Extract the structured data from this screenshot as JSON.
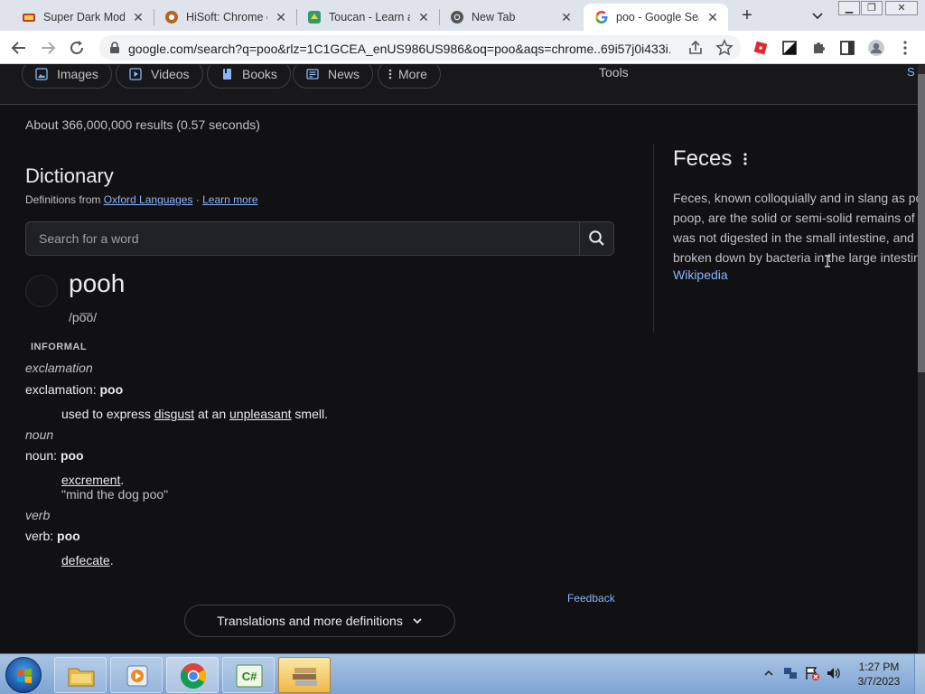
{
  "browser": {
    "tabs": [
      {
        "title": "Super Dark Mode",
        "icon": "super-dark-mode-icon",
        "active": false
      },
      {
        "title": "HiSoft: Chrome ex",
        "icon": "hisoft-icon",
        "active": false
      },
      {
        "title": "Toucan - Learn a",
        "icon": "toucan-icon",
        "active": false
      },
      {
        "title": "New Tab",
        "icon": "chrome-icon",
        "active": false
      },
      {
        "title": "poo - Google Sea",
        "icon": "google-icon",
        "active": true
      }
    ],
    "new_tab_label": "+",
    "url": "google.com/search?q=poo&rlz=1C1GCEA_enUS986US986&oq=poo&aqs=chrome..69i57j0i433i..."
  },
  "search_tabs": {
    "items": [
      {
        "label": "Images",
        "icon": "image-icon"
      },
      {
        "label": "Videos",
        "icon": "video-icon"
      },
      {
        "label": "Books",
        "icon": "book-icon"
      },
      {
        "label": "News",
        "icon": "news-icon"
      },
      {
        "label": "More",
        "icon": "more-vert-icon"
      }
    ],
    "tools": "Tools",
    "right_edge": "S"
  },
  "result_stats": "About 366,000,000 results (0.57 seconds)",
  "dictionary": {
    "title": "Dictionary",
    "from_prefix": "Definitions from ",
    "source": "Oxford Languages",
    "separator": " · ",
    "learn_more": "Learn more",
    "search_placeholder": "Search for a word",
    "word": "pooh",
    "phonetic": "/po͞o/",
    "register": "INFORMAL",
    "entries": [
      {
        "pos": "exclamation",
        "label": "exclamation: ",
        "headword": "poo",
        "def_parts": [
          "used to express ",
          "disgust",
          " at an ",
          "unpleasant",
          " smell."
        ],
        "example": ""
      },
      {
        "pos": "noun",
        "label": "noun: ",
        "headword": "poo",
        "def_parts": [
          "",
          "excrement",
          "."
        ],
        "example": "\"mind the dog poo\""
      },
      {
        "pos": "verb",
        "label": "verb: ",
        "headword": "poo",
        "def_parts": [
          "",
          "defecate",
          "."
        ],
        "example": ""
      }
    ],
    "feedback": "Feedback",
    "translations_button": "Translations and more definitions"
  },
  "knowledge_panel": {
    "title": "Feces",
    "desc_lines": [
      "Feces, known colloquially and in slang as po",
      "poop, are the solid or semi-solid remains of",
      "was not digested in the small intestine, and",
      "broken down by bacteria in the large intestin"
    ],
    "source_link": "Wikipedia"
  },
  "taskbar": {
    "apps": [
      "file-explorer",
      "media-player",
      "chrome",
      "csharp-editor",
      "stacked-app"
    ],
    "time": "1:27 PM",
    "date": "3/7/2023"
  },
  "colors": {
    "page_bg": "#111113",
    "link": "#8ab4f8",
    "text": "#e8eaed",
    "muted_text": "#bdc1c6"
  }
}
